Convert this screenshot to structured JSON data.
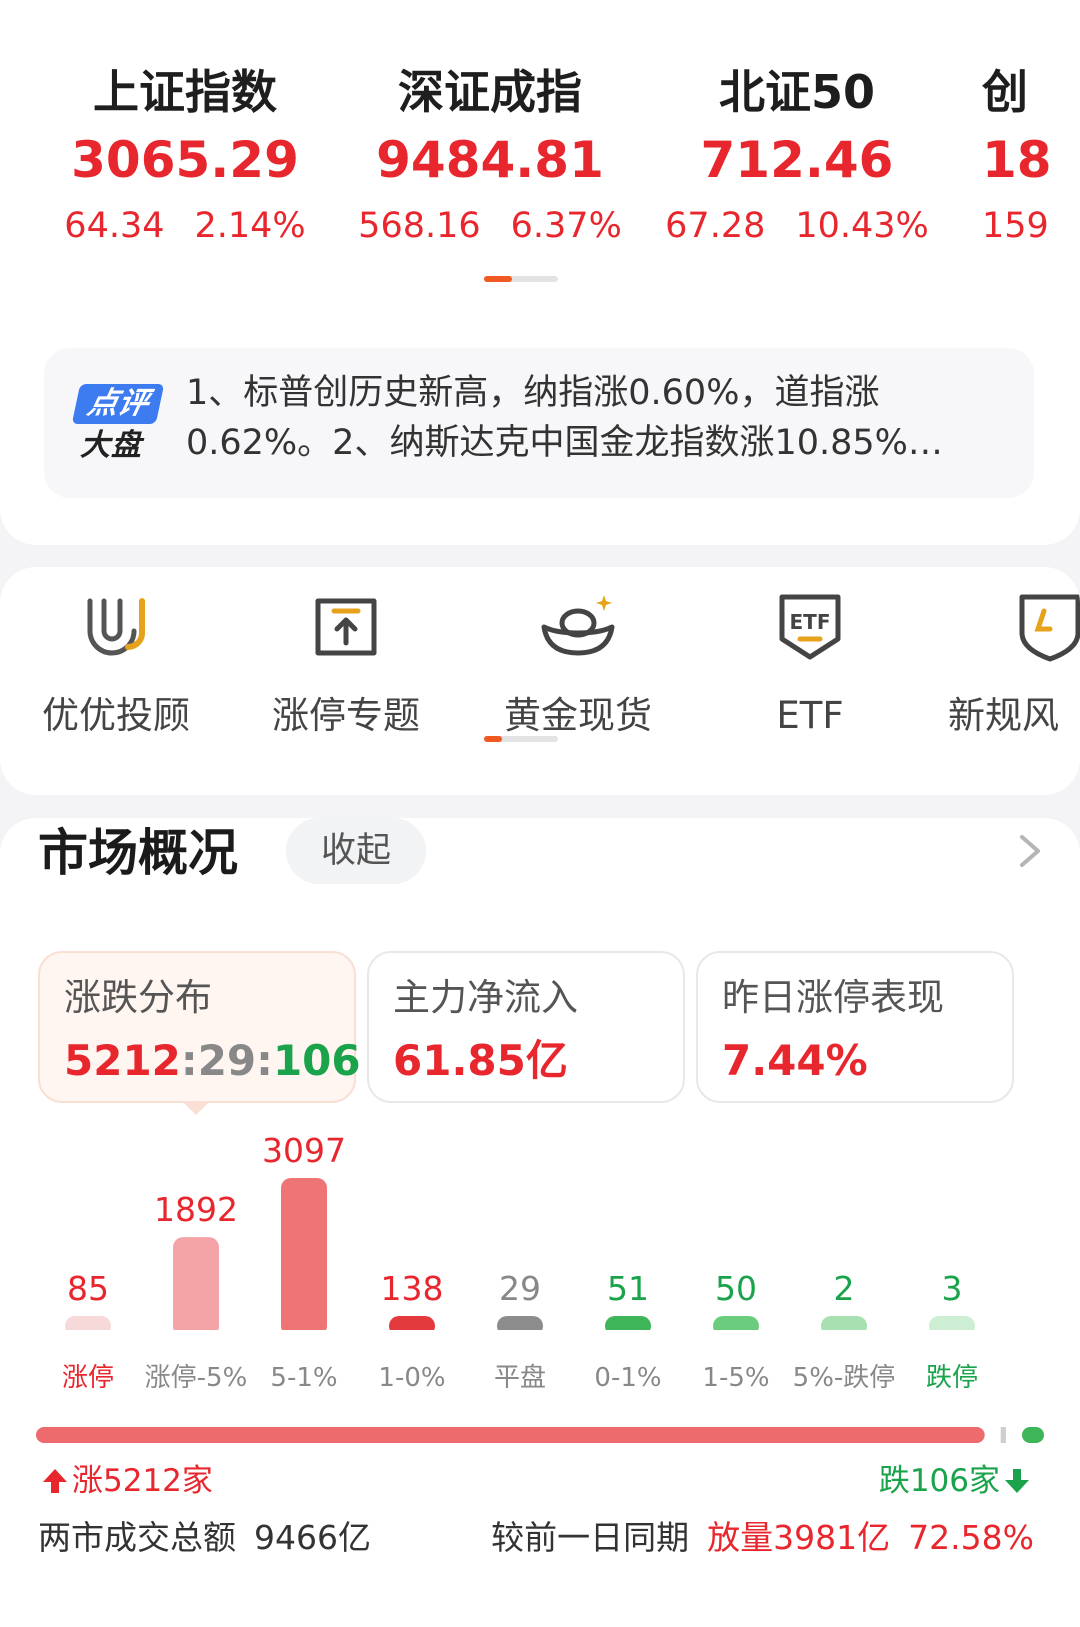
{
  "indices": [
    {
      "name": "上证指数",
      "price": "3065.29",
      "change": "64.34",
      "pct": "2.14%"
    },
    {
      "name": "深证成指",
      "price": "9484.81",
      "change": "568.16",
      "pct": "6.37%"
    },
    {
      "name": "北证50",
      "price": "712.46",
      "change": "67.28",
      "pct": "10.43%"
    },
    {
      "name": "创",
      "price": "18",
      "change": "159",
      "pct": ""
    }
  ],
  "commentary": {
    "logo_top": "点评",
    "logo_bottom": "大盘",
    "text": "1、标普创历史新高，纳指涨0.60%，道指涨0.62%。2、纳斯达克中国金龙指数涨10.85%…"
  },
  "shortcuts": [
    {
      "label": "优优投顾",
      "icon": "uu-logo-icon"
    },
    {
      "label": "涨停专题",
      "icon": "upload-box-icon"
    },
    {
      "label": "黄金现货",
      "icon": "gold-ingot-icon"
    },
    {
      "label": "ETF",
      "icon": "etf-badge-icon"
    },
    {
      "label": "新规风",
      "icon": "shield-icon"
    }
  ],
  "market": {
    "title": "市场概况",
    "collapse_label": "收起",
    "tiles": [
      {
        "label": "涨跌分布",
        "up": "5212",
        "sep1": ":",
        "flat": "29",
        "sep2": ":",
        "down": "106"
      },
      {
        "label": "主力净流入",
        "value": "61.85亿"
      },
      {
        "label": "昨日涨停表现",
        "value": "7.44%"
      }
    ],
    "up_text": "涨5212家",
    "down_text": "跌106家",
    "turnover_label": "两市成交总额",
    "turnover_value": "9466亿",
    "compare_label": "较前一日同期",
    "compare_volume": "放量3981亿",
    "compare_pct": "72.58%"
  },
  "colors": {
    "red": "#e8262d",
    "green": "#1aa34a",
    "accent_orange": "#f05a22",
    "gray": "#888888"
  },
  "chart_data": {
    "type": "bar",
    "categories": [
      "涨停",
      "涨停-5%",
      "5-1%",
      "1-0%",
      "平盘",
      "0-1%",
      "1-5%",
      "5%-跌停",
      "跌停"
    ],
    "values": [
      85,
      1892,
      3097,
      138,
      29,
      51,
      50,
      2,
      3
    ],
    "bar_colors": [
      "#f8d9d9",
      "#f4a3a6",
      "#ee7476",
      "#e33a3d",
      "#8c8c8c",
      "#3fb55a",
      "#6ccc7d",
      "#a8e0b1",
      "#cdeed3"
    ],
    "value_colors": [
      "#e8262d",
      "#e8262d",
      "#e8262d",
      "#e8262d",
      "#888888",
      "#1aa34a",
      "#1aa34a",
      "#1aa34a",
      "#1aa34a"
    ],
    "label_colors": [
      "#e8262d",
      "#888888",
      "#888888",
      "#888888",
      "#888888",
      "#888888",
      "#888888",
      "#888888",
      "#1aa34a"
    ],
    "ratio": {
      "up": 5212,
      "flat": 29,
      "down": 106
    }
  }
}
